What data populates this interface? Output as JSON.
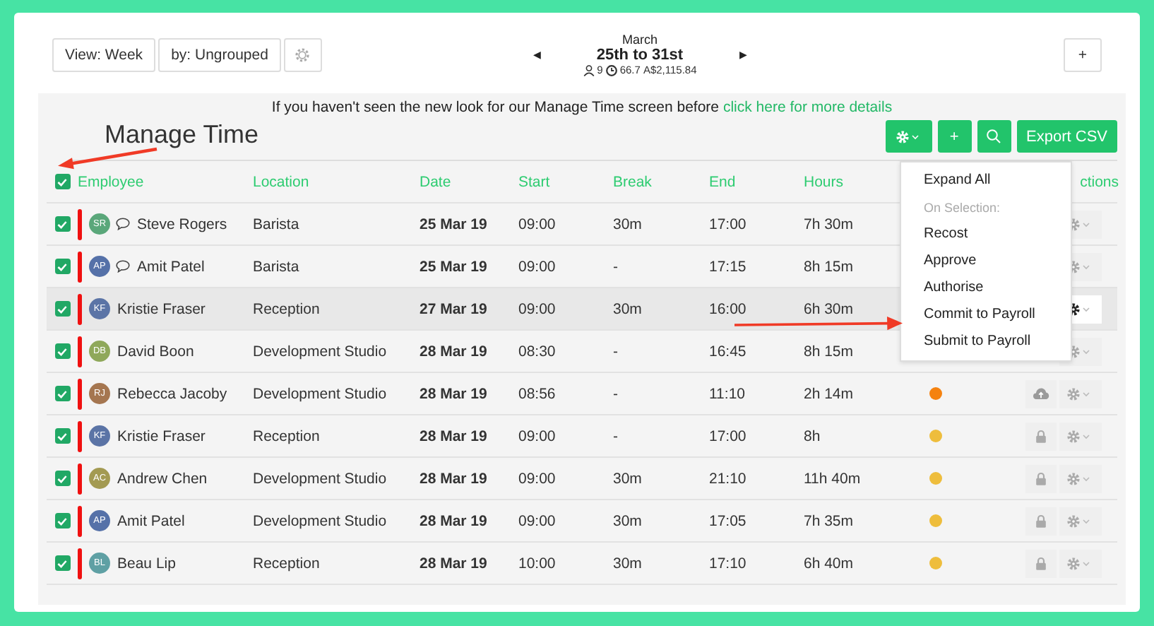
{
  "toolbar": {
    "buttons": [
      "View: Week",
      "by: Ungrouped"
    ],
    "prev": "◀",
    "next": "▶",
    "month": "March",
    "range": "25th to 31st",
    "people": "9",
    "hours": "66.7",
    "cost": "A$2,115.84",
    "add": "+"
  },
  "notice": {
    "text": "If you haven't seen the new look for our Manage Time screen before",
    "link": "click here for more details"
  },
  "title": "Manage Time",
  "actions": {
    "add": "+",
    "export": "Export CSV"
  },
  "menu": {
    "items": [
      {
        "kind": "item",
        "label": "Expand All"
      },
      {
        "kind": "heading",
        "label": "On Selection:"
      },
      {
        "kind": "item",
        "label": "Recost"
      },
      {
        "kind": "item",
        "label": "Approve"
      },
      {
        "kind": "item",
        "label": "Authorise"
      },
      {
        "kind": "item",
        "label": "Commit to Payroll"
      },
      {
        "kind": "item",
        "label": "Submit to Payroll"
      }
    ]
  },
  "table": {
    "all_checked": true,
    "columns": [
      "Employee",
      "Location",
      "Date",
      "Start",
      "Break",
      "End",
      "Hours",
      "ctions"
    ],
    "rows": [
      {
        "checked": true,
        "highlighted": false,
        "initials": "SR",
        "color": "#5aa77a",
        "comment": true,
        "employee": "Steve Rogers",
        "location": "Barista",
        "date": "25 Mar 19",
        "start": "09:00",
        "break": "30m",
        "end": "17:00",
        "hours": "7h 30m"
      },
      {
        "checked": true,
        "highlighted": false,
        "initials": "AP",
        "color": "#5571a8",
        "comment": true,
        "employee": "Amit Patel",
        "location": "Barista",
        "date": "25 Mar 19",
        "start": "09:00",
        "break": "-",
        "end": "17:15",
        "hours": "8h 15m"
      },
      {
        "checked": true,
        "highlighted": true,
        "initials": "KF",
        "color": "#5b74a6",
        "comment": false,
        "employee": "Kristie Fraser",
        "location": "Reception",
        "date": "27 Mar 19",
        "start": "09:00",
        "break": "30m",
        "end": "16:00",
        "hours": "6h 30m"
      },
      {
        "checked": true,
        "highlighted": false,
        "initials": "DB",
        "color": "#8fa85a",
        "comment": false,
        "employee": "David Boon",
        "location": "Development Studio",
        "date": "28 Mar 19",
        "start": "08:30",
        "break": "-",
        "end": "16:45",
        "hours": "8h 15m"
      },
      {
        "checked": true,
        "highlighted": false,
        "initials": "RJ",
        "color": "#a57650",
        "comment": false,
        "employee": "Rebecca Jacoby",
        "location": "Development Studio",
        "date": "28 Mar 19",
        "start": "08:56",
        "break": "-",
        "end": "11:10",
        "hours": "2h 14m",
        "status": {
          "color": "#f5820f"
        },
        "locked": false
      },
      {
        "checked": true,
        "highlighted": false,
        "initials": "KF",
        "color": "#5b74a6",
        "comment": false,
        "employee": "Kristie Fraser",
        "location": "Reception",
        "date": "28 Mar 19",
        "start": "09:00",
        "break": "-",
        "end": "17:00",
        "hours": "8h",
        "status": {
          "color": "#eebd3c"
        },
        "locked": true
      },
      {
        "checked": true,
        "highlighted": false,
        "initials": "AC",
        "color": "#a39a52",
        "comment": false,
        "employee": "Andrew Chen",
        "location": "Development Studio",
        "date": "28 Mar 19",
        "start": "09:00",
        "break": "30m",
        "end": "21:10",
        "hours": "11h 40m",
        "status": {
          "color": "#eebd3c"
        },
        "locked": true
      },
      {
        "checked": true,
        "highlighted": false,
        "initials": "AP",
        "color": "#5571a8",
        "comment": false,
        "employee": "Amit Patel",
        "location": "Development Studio",
        "date": "28 Mar 19",
        "start": "09:00",
        "break": "30m",
        "end": "17:05",
        "hours": "7h 35m",
        "status": {
          "color": "#eebd3c"
        },
        "locked": true
      },
      {
        "checked": true,
        "highlighted": false,
        "initials": "BL",
        "color": "#5fa0a4",
        "comment": false,
        "employee": "Beau Lip",
        "location": "Reception",
        "date": "28 Mar 19",
        "start": "10:00",
        "break": "30m",
        "end": "17:10",
        "hours": "6h 40m",
        "status": {
          "color": "#eebd3c"
        },
        "locked": true
      }
    ]
  }
}
